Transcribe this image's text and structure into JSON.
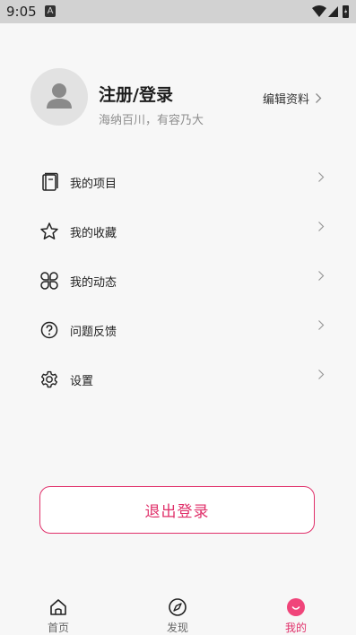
{
  "status_bar": {
    "time": "9:05",
    "notification_icon": "A"
  },
  "profile": {
    "username": "注册/登录",
    "motto": "海纳百川，有容乃大",
    "edit_label": "编辑资料"
  },
  "menu": {
    "items": [
      {
        "label": "我的项目",
        "icon": "notebook-icon"
      },
      {
        "label": "我的收藏",
        "icon": "star-icon"
      },
      {
        "label": "我的动态",
        "icon": "clover-icon"
      },
      {
        "label": "问题反馈",
        "icon": "question-icon"
      },
      {
        "label": "设置",
        "icon": "gear-icon"
      }
    ]
  },
  "logout_label": "退出登录",
  "tabs": [
    {
      "label": "首页",
      "icon": "home-icon",
      "active": false
    },
    {
      "label": "发现",
      "icon": "compass-icon",
      "active": false
    },
    {
      "label": "我的",
      "icon": "smile-icon",
      "active": true
    }
  ],
  "colors": {
    "accent": "#e0306a",
    "background": "#f7f7f7",
    "status_bar": "#d2d2d2"
  }
}
